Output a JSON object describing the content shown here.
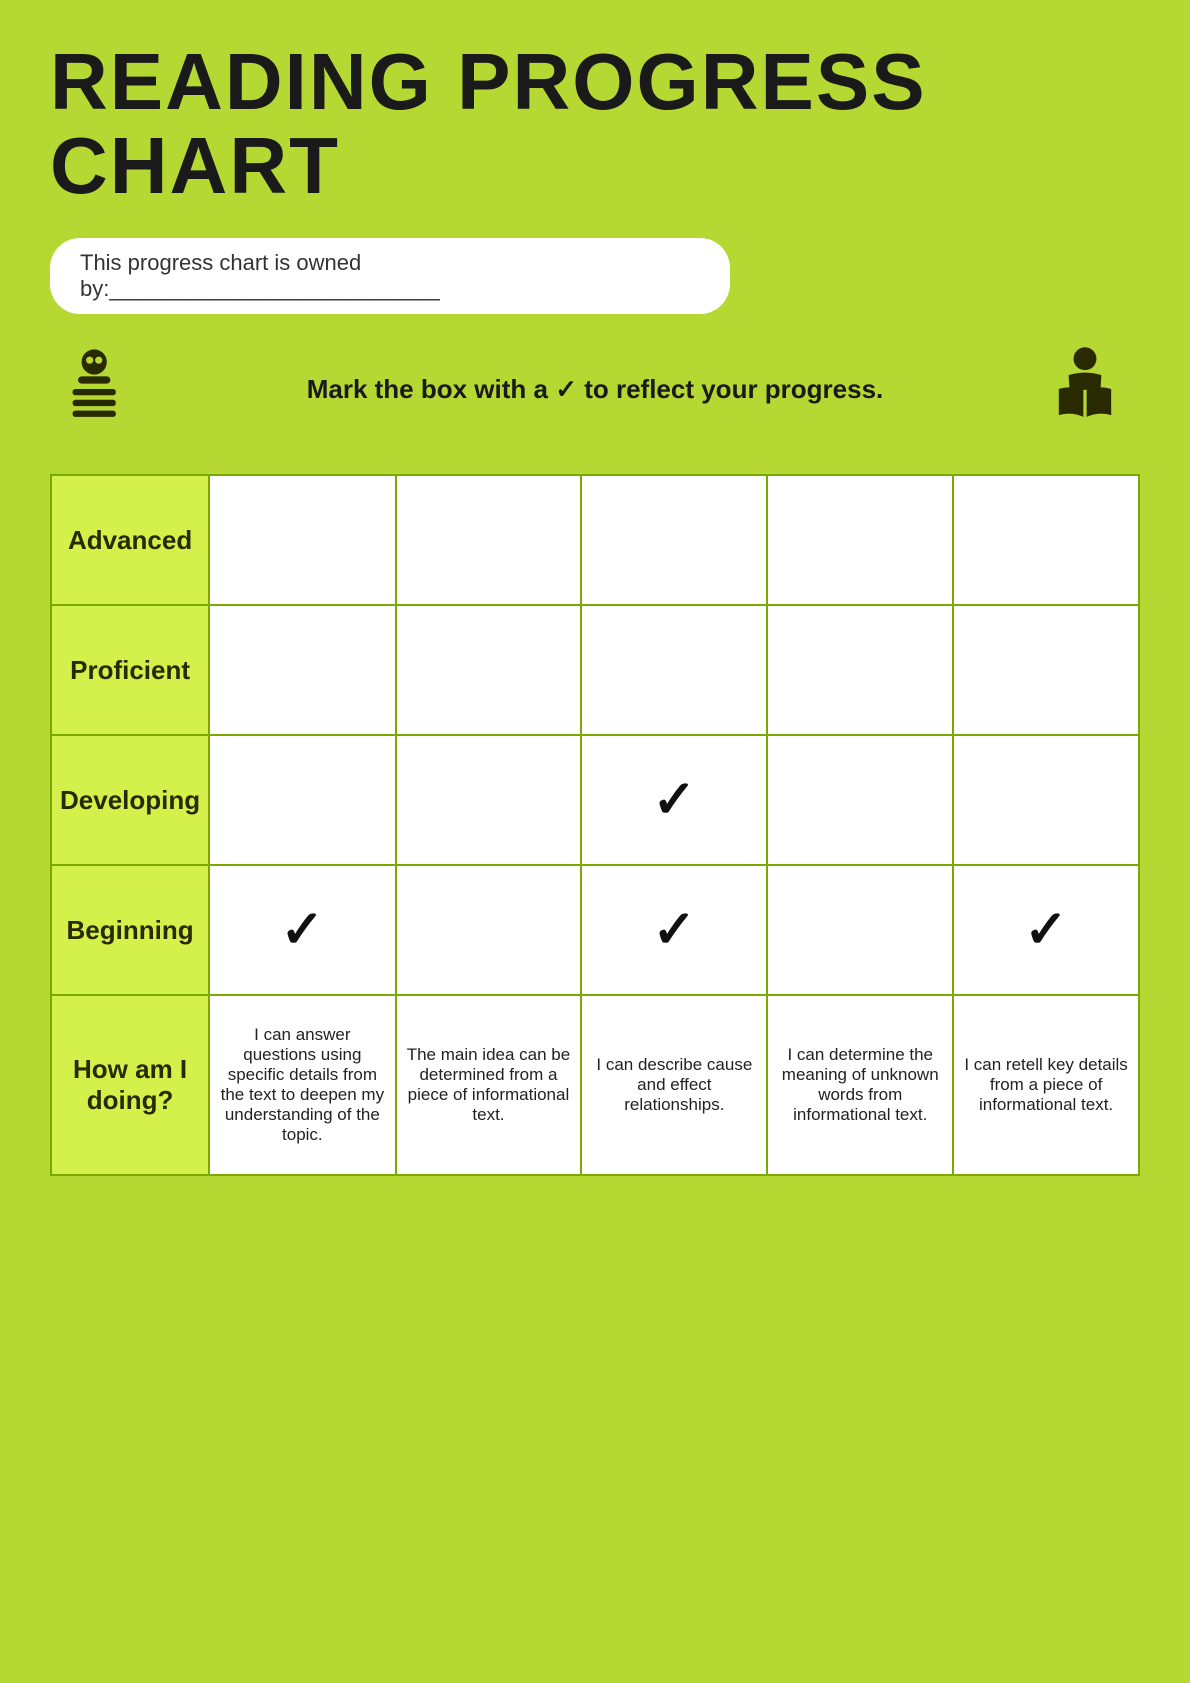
{
  "title": "READING PROGRESS CHART",
  "owner_label": "This progress chart is owned by:___________________________",
  "instruction": "Mark the box with a ✓ to reflect your progress.",
  "rows": [
    {
      "label": "Advanced"
    },
    {
      "label": "Proficient"
    },
    {
      "label": "Developing"
    },
    {
      "label": "Beginning"
    }
  ],
  "how_am_i_label": "How am I doing?",
  "descriptions": [
    "I can answer questions using specific details from the text to deepen my understanding of the topic.",
    "The main idea can be determined from a piece of informational text.",
    "I can describe cause and effect relationships.",
    "I can determine the meaning of unknown words from informational text.",
    "I can retell key details from a piece of informational text."
  ],
  "checks": {
    "Advanced": [
      false,
      false,
      false,
      false,
      false
    ],
    "Proficient": [
      false,
      false,
      false,
      false,
      false
    ],
    "Developing": [
      false,
      false,
      true,
      false,
      false
    ],
    "Beginning": [
      true,
      false,
      true,
      false,
      true
    ]
  }
}
